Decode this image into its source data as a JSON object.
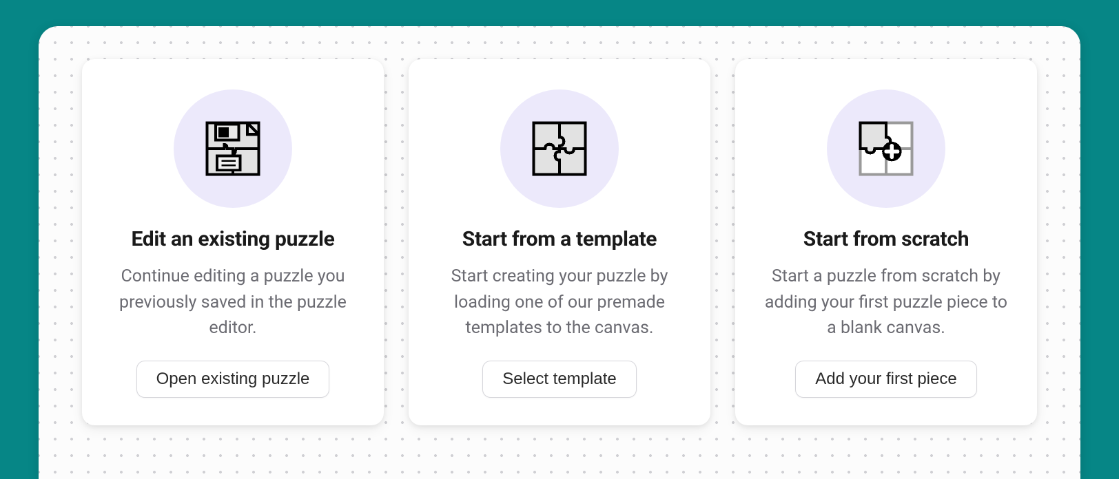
{
  "cards": [
    {
      "title": "Edit an existing puzzle",
      "description": "Continue editing a puzzle you previously saved in the puzzle editor.",
      "button_label": "Open existing puzzle",
      "icon": "floppy-puzzle-icon"
    },
    {
      "title": "Start from a template",
      "description": "Start creating your puzzle by loading one of our premade templates to the canvas.",
      "button_label": "Select template",
      "icon": "puzzle-template-icon"
    },
    {
      "title": "Start from scratch",
      "description": "Start a puzzle from scratch by adding your first puzzle piece to a blank canvas.",
      "button_label": "Add your first piece",
      "icon": "puzzle-add-icon"
    }
  ],
  "colors": {
    "page_background": "#068686",
    "panel_background": "#fcfcfc",
    "icon_circle": "#ece9fb",
    "title_text": "#1a1a1a",
    "desc_text": "#6b6b72"
  }
}
